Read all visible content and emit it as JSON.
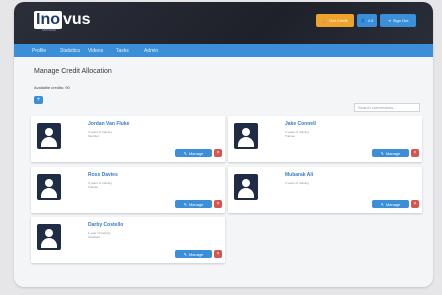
{
  "header": {
    "logo_box": "Ino",
    "logo_rest": "vus",
    "logo_sub": "Medical",
    "buttons": [
      {
        "label": "Get Credit",
        "icon": "cart-icon",
        "color": "#f0a32a"
      },
      {
        "label": "4.3",
        "icon": "user-icon",
        "color": "#3a8fd8"
      },
      {
        "label": "Sign Out",
        "icon": "exit-icon",
        "color": "#3a8fd8"
      }
    ]
  },
  "nav": {
    "items": [
      "Profile",
      "Statistics",
      "Videos",
      "Tasks",
      "Admin"
    ]
  },
  "page": {
    "title": "Manage Credit Allocation",
    "credits": "Available credits: 90",
    "add_label": "+",
    "search_placeholder": "Search connections..."
  },
  "cards": [
    {
      "name": "Jordan Van Fluke",
      "line1": "3 years of training",
      "line2": "Member",
      "manage": "Manage",
      "delete": "×"
    },
    {
      "name": "Jake Connell",
      "line1": "3 years of training",
      "line2": "Trainee",
      "manage": "Manage",
      "delete": "×"
    },
    {
      "name": "Ross Davies",
      "line1": "3 years of training",
      "line2": "Trainee",
      "manage": "Manage",
      "delete": "×"
    },
    {
      "name": "Mubarak Ali",
      "line1": "3 years of training",
      "line2": "",
      "manage": "Manage",
      "delete": "×"
    },
    {
      "name": "Darby Costello",
      "line1": "1 year of training",
      "line2": "Assistant",
      "manage": "Manage",
      "delete": "×"
    }
  ],
  "colors": {
    "accent": "#3a8fd8",
    "danger": "#d9534f",
    "warning": "#f0a32a",
    "header": "#1e2129"
  }
}
